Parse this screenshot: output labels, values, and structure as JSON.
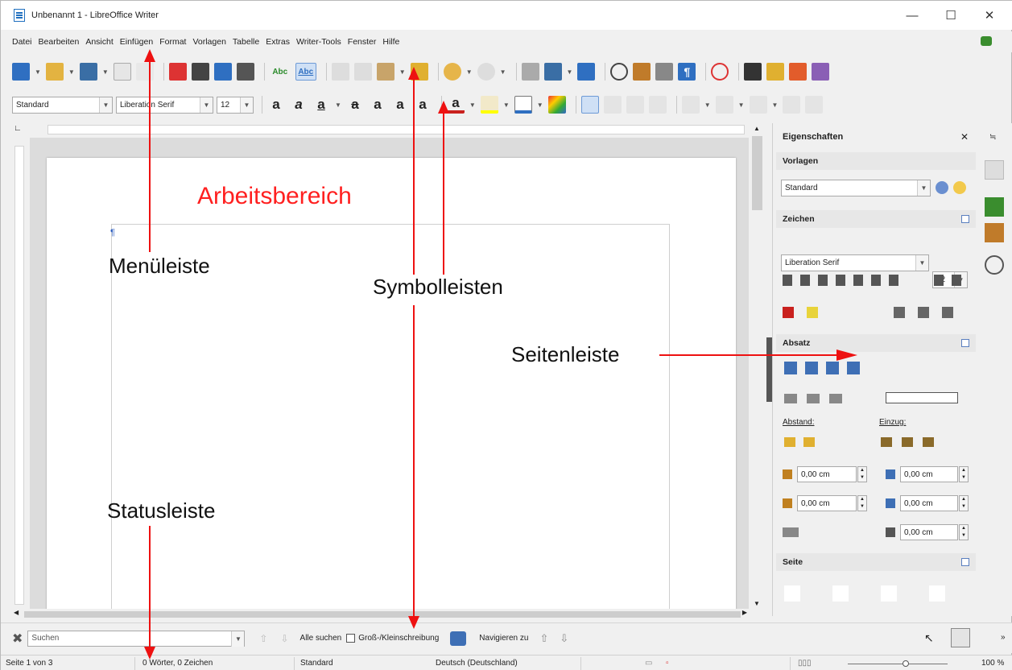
{
  "window": {
    "title": "Unbenannt 1 - LibreOffice Writer",
    "minimize": "—",
    "maximize": "☐",
    "close": "✕"
  },
  "menu": [
    "Datei",
    "Bearbeiten",
    "Ansicht",
    "Einfügen",
    "Format",
    "Vorlagen",
    "Tabelle",
    "Extras",
    "Writer-Tools",
    "Fenster",
    "Hilfe"
  ],
  "format_toolbar": {
    "paragraph_style": "Standard",
    "font_name": "Liberation Serif",
    "font_size": "12"
  },
  "toolbar_glyphs": {
    "spell_a": "Abc",
    "spell_b": "Abc",
    "format_paint": "¶",
    "bold": "a",
    "italic": "a",
    "underline": "a",
    "strike": "a",
    "superscript": "a",
    "subscript": "a",
    "shadow": "a",
    "font_color": "a"
  },
  "sidebar": {
    "title": "Eigenschaften",
    "close": "✕",
    "vorlagen": {
      "header": "Vorlagen",
      "style": "Standard"
    },
    "zeichen": {
      "header": "Zeichen",
      "font": "Liberation Serif",
      "size": "12"
    },
    "absatz": {
      "header": "Absatz",
      "abstand": "Abstand:",
      "einzug": "Einzug:",
      "spacing_above": "0,00 cm",
      "spacing_below": "0,00 cm",
      "indent_before": "0,00 cm",
      "indent_after": "0,00 cm",
      "first_line": "0,00 cm"
    },
    "seite": {
      "header": "Seite"
    }
  },
  "findbar": {
    "search_placeholder": "Suchen",
    "find_all": "Alle suchen",
    "match_case": "Groß-/Kleinschreibung",
    "navigate": "Navigieren zu",
    "more": "»"
  },
  "status": {
    "page": "Seite 1 von 3",
    "words": "0 Wörter, 0 Zeichen",
    "style": "Standard",
    "language": "Deutsch (Deutschland)",
    "zoom": "100 %"
  },
  "annotations": {
    "arbeitsbereich": "Arbeitsbereich",
    "menueleiste": "Menüleiste",
    "symbolleisten": "Symbolleisten",
    "seitenleiste": "Seitenleiste",
    "statusleiste": "Statusleiste"
  }
}
